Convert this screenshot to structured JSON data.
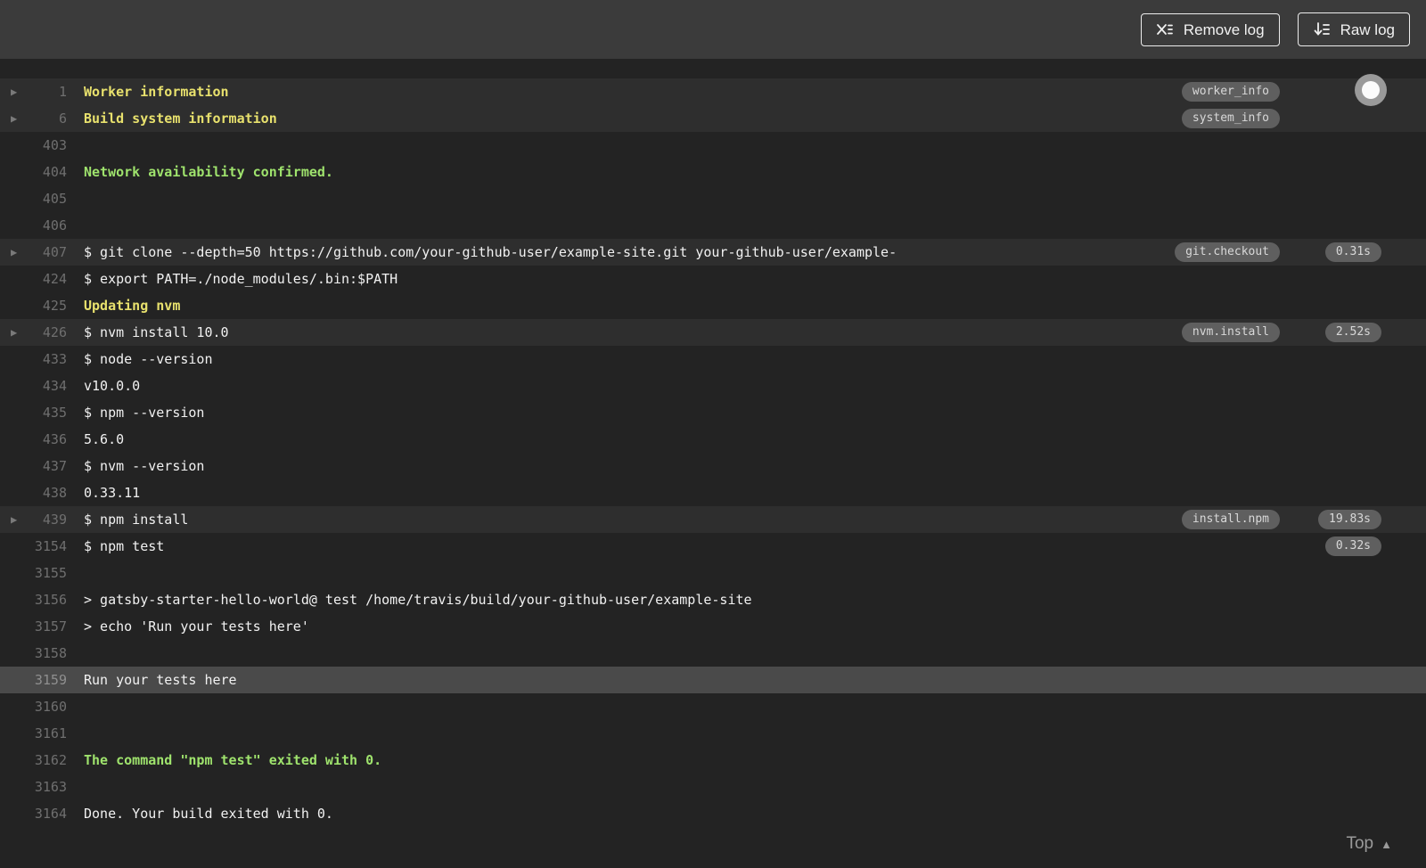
{
  "header": {
    "remove_log_label": "Remove log",
    "raw_log_label": "Raw log"
  },
  "log": {
    "rows": [
      {
        "num": "1",
        "text": "Worker information",
        "style": "yellow",
        "fold": true,
        "highlight": true,
        "tag": "worker_info"
      },
      {
        "num": "6",
        "text": "Build system information",
        "style": "yellow",
        "fold": true,
        "highlight": true,
        "tag": "system_info"
      },
      {
        "num": "403",
        "text": ""
      },
      {
        "num": "404",
        "text": "Network availability confirmed.",
        "style": "green"
      },
      {
        "num": "405",
        "text": ""
      },
      {
        "num": "406",
        "text": ""
      },
      {
        "num": "407",
        "text": "$ git clone --depth=50 https://github.com/your-github-user/example-site.git your-github-user/example-",
        "fold": true,
        "highlight": true,
        "tag": "git.checkout",
        "duration": "0.31s"
      },
      {
        "num": "424",
        "text": "$ export PATH=./node_modules/.bin:$PATH"
      },
      {
        "num": "425",
        "text": "Updating nvm",
        "style": "yellow"
      },
      {
        "num": "426",
        "text": "$ nvm install 10.0",
        "fold": true,
        "highlight": true,
        "tag": "nvm.install",
        "duration": "2.52s"
      },
      {
        "num": "433",
        "text": "$ node --version"
      },
      {
        "num": "434",
        "text": "v10.0.0"
      },
      {
        "num": "435",
        "text": "$ npm --version"
      },
      {
        "num": "436",
        "text": "5.6.0"
      },
      {
        "num": "437",
        "text": "$ nvm --version"
      },
      {
        "num": "438",
        "text": "0.33.11"
      },
      {
        "num": "439",
        "text": "$ npm install",
        "fold": true,
        "highlight": true,
        "tag": "install.npm",
        "duration": "19.83s"
      },
      {
        "num": "3154",
        "text": "$ npm test",
        "duration": "0.32s"
      },
      {
        "num": "3155",
        "text": ""
      },
      {
        "num": "3156",
        "text": "> gatsby-starter-hello-world@ test /home/travis/build/your-github-user/example-site"
      },
      {
        "num": "3157",
        "text": "> echo 'Run your tests here'"
      },
      {
        "num": "3158",
        "text": ""
      },
      {
        "num": "3159",
        "text": "Run your tests here",
        "selected": true
      },
      {
        "num": "3160",
        "text": ""
      },
      {
        "num": "3161",
        "text": ""
      },
      {
        "num": "3162",
        "text": "The command \"npm test\" exited with 0.",
        "style": "green"
      },
      {
        "num": "3163",
        "text": ""
      },
      {
        "num": "3164",
        "text": "Done. Your build exited with 0."
      }
    ],
    "top_link_label": "Top",
    "fold_arrow_glyph": "▶",
    "top_arrow_glyph": "▲"
  },
  "colors": {
    "header_bg": "#3b3b3b",
    "log_bg": "#232323",
    "fold_row_bg": "#2e2e2e",
    "selected_row_bg": "#4a4a4a",
    "text": "#f1f1f1",
    "yellow": "#e8e16d",
    "green": "#9fe36d",
    "muted": "#6f6f6f",
    "pill_bg": "#5f5f5f",
    "pill_text": "#d8d8d8"
  }
}
